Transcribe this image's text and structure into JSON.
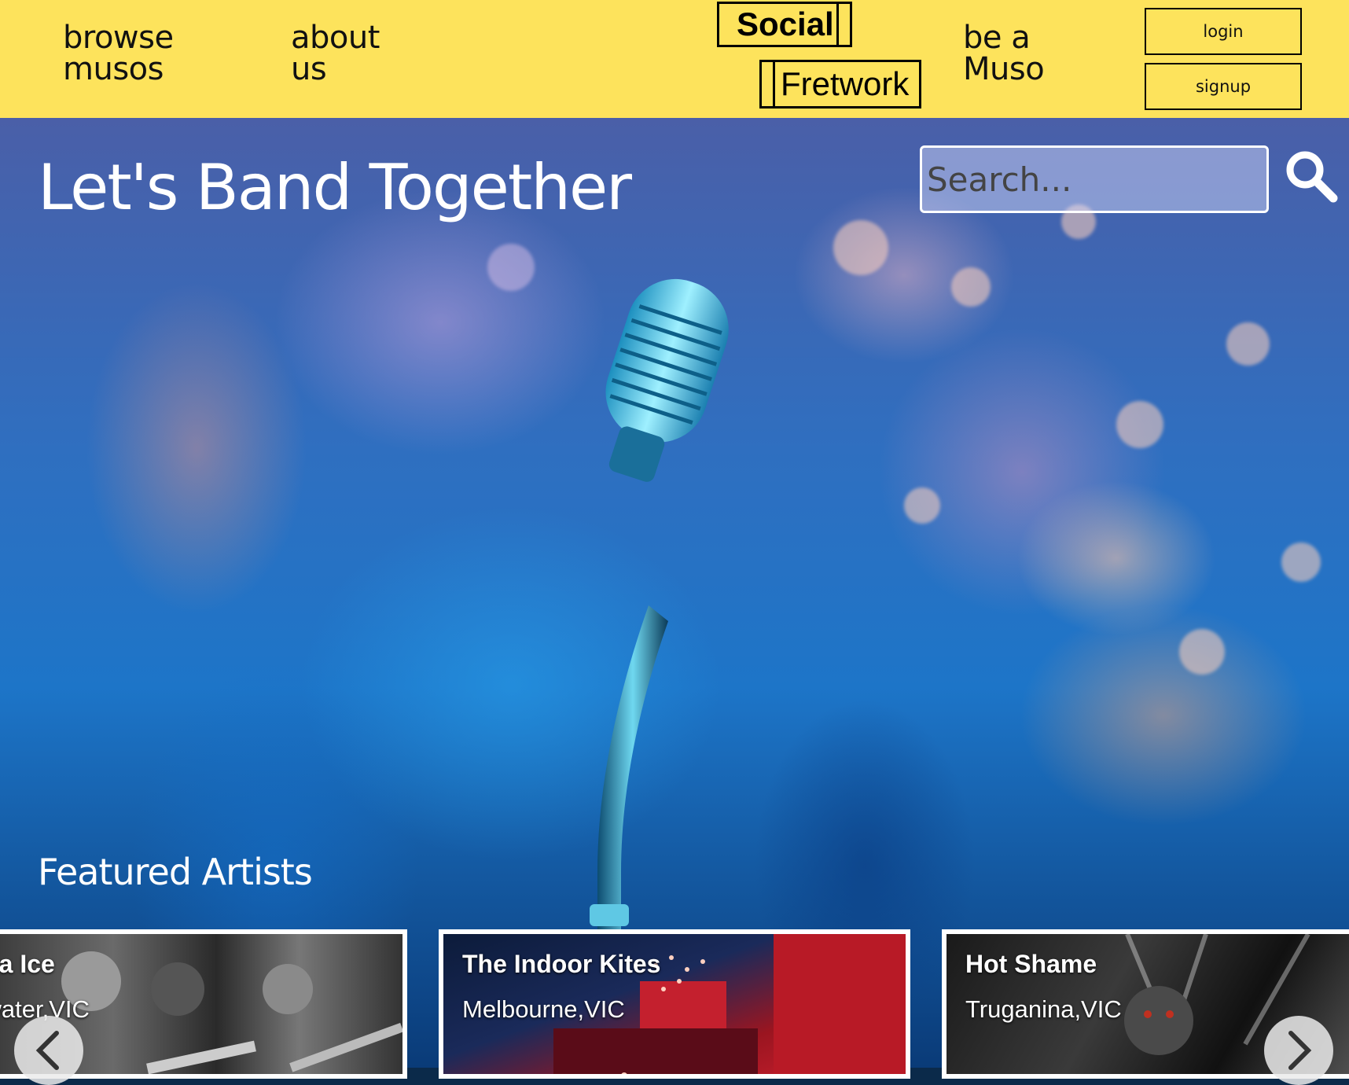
{
  "header": {
    "nav": {
      "browse": [
        "browse",
        "musos"
      ],
      "about": [
        "about",
        "us"
      ],
      "muso": [
        "be a",
        "Muso"
      ]
    },
    "logo": {
      "line1": "Social",
      "line2": "Fretwork"
    },
    "login_label": "login",
    "signup_label": "signup",
    "bg_color": "#fde35c"
  },
  "hero": {
    "title": "Let's Band Together",
    "search": {
      "placeholder": "Search...",
      "icon": "search-icon"
    }
  },
  "featured": {
    "title": "Featured Artists",
    "artists": [
      {
        "name": "illa Ice",
        "location": "swater,VIC"
      },
      {
        "name": "The Indoor Kites",
        "location": "Melbourne,VIC"
      },
      {
        "name": "Hot Shame",
        "location": "Truganina,VIC"
      }
    ],
    "prev_icon": "chevron-left-icon",
    "next_icon": "chevron-right-icon"
  }
}
